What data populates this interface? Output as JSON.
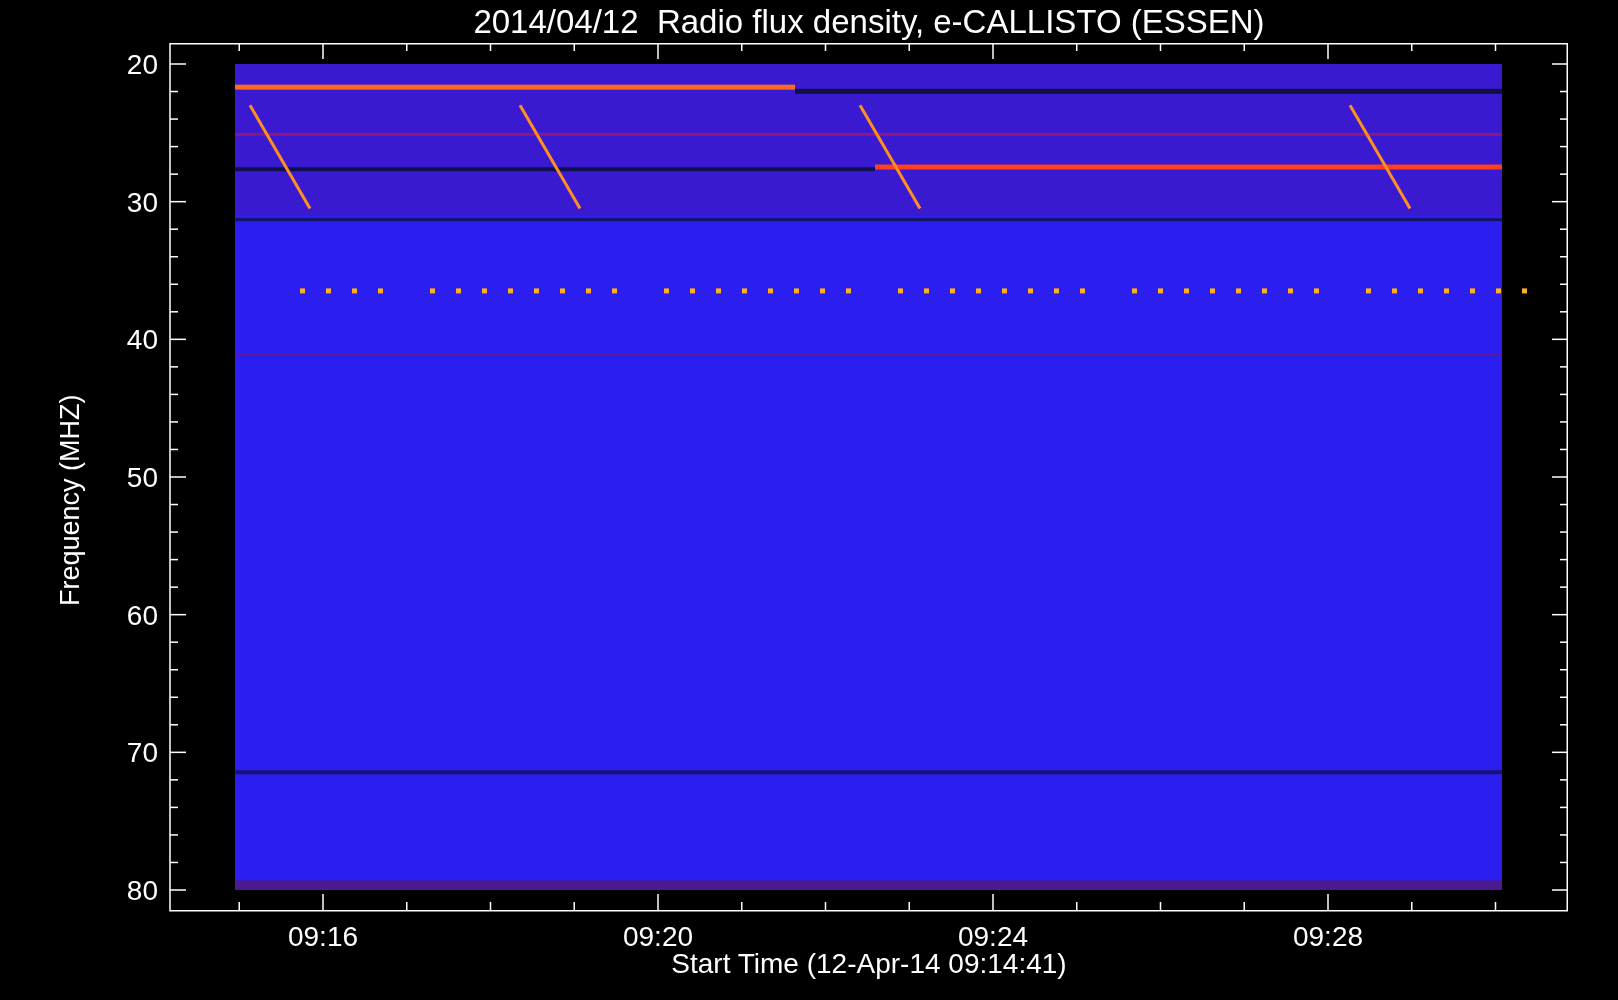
{
  "title": "2014/04/12  Radio flux density, e-CALLISTO (ESSEN)",
  "y_axis": {
    "label": "Frequency (MHZ)",
    "ticks": [
      "20",
      "30",
      "40",
      "50",
      "60",
      "70",
      "80"
    ]
  },
  "x_axis": {
    "label": "Start Time (12-Apr-14 09:14:41)",
    "ticks": [
      "09:16",
      "09:20",
      "09:24",
      "09:28"
    ]
  }
}
